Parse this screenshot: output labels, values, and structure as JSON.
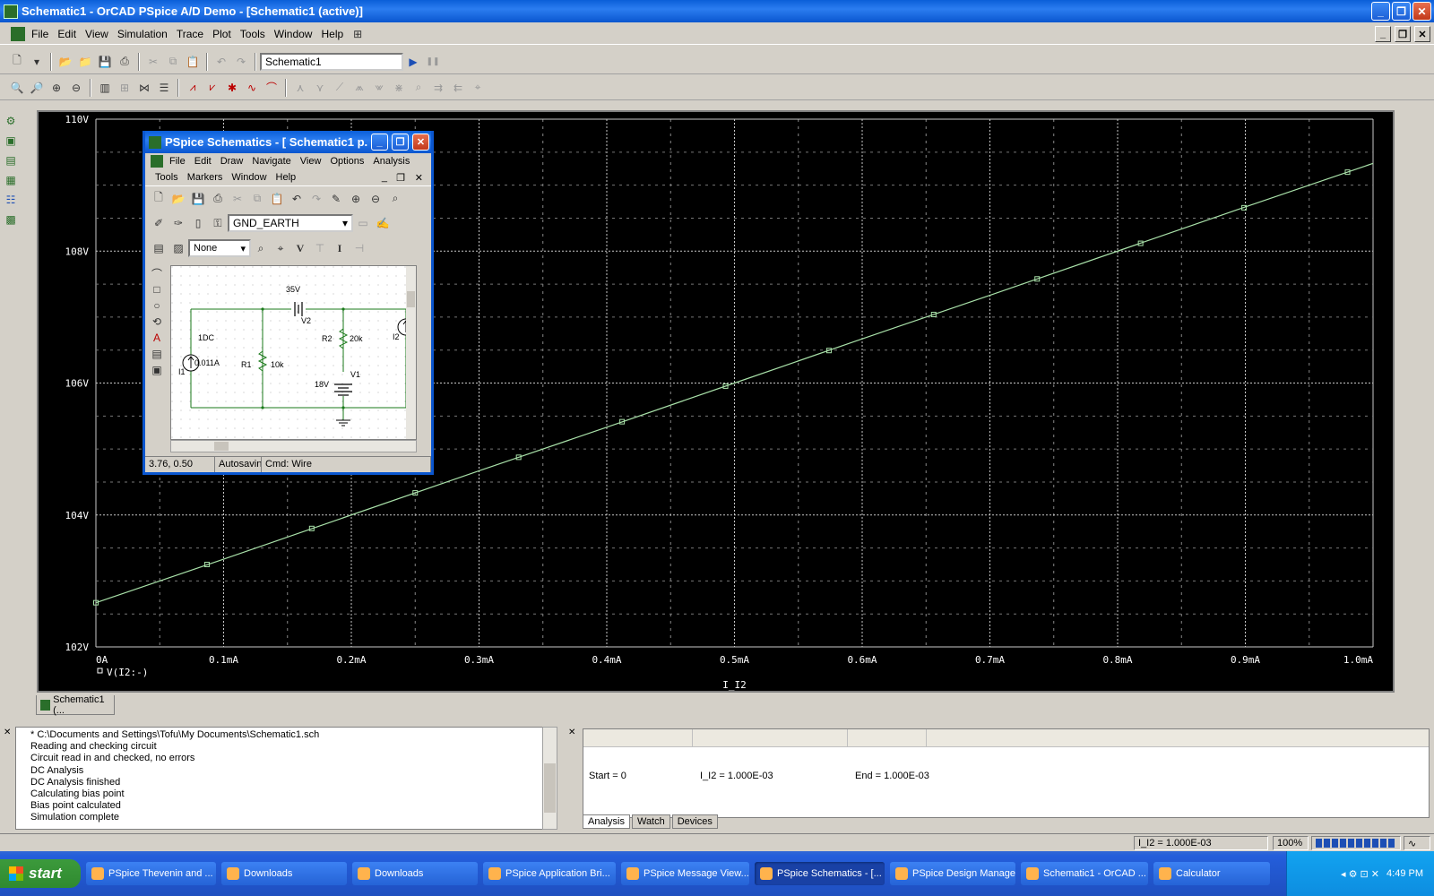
{
  "window": {
    "title": "Schematic1 - OrCAD PSpice A/D Demo  - [Schematic1 (active)]",
    "minimize": "_",
    "maximize": "❐",
    "close": "✕"
  },
  "menu": [
    "File",
    "Edit",
    "View",
    "Simulation",
    "Trace",
    "Plot",
    "Tools",
    "Window",
    "Help"
  ],
  "toolbar": {
    "profile_combo": "Schematic1",
    "run": "▶",
    "pause": "❚❚"
  },
  "plot": {
    "y_ticks": [
      "110V",
      "108V",
      "106V",
      "104V",
      "102V"
    ],
    "x_ticks": [
      "0A",
      "0.1mA",
      "0.2mA",
      "0.3mA",
      "0.4mA",
      "0.5mA",
      "0.6mA",
      "0.7mA",
      "0.8mA",
      "0.9mA",
      "1.0mA"
    ],
    "trace_label": "V(I2:-)",
    "x_label": "I_I2",
    "tab_label": "Schematic1 (..."
  },
  "chart_data": {
    "type": "line",
    "xlabel": "I_I2",
    "ylabel": "",
    "x_unit": "mA",
    "xlim": [
      0,
      1.0
    ],
    "ylim": [
      102,
      110
    ],
    "grid": true,
    "series": [
      {
        "name": "V(I2:-)",
        "x": [
          0,
          0.1,
          0.2,
          0.3,
          0.4,
          0.5,
          0.6,
          0.7,
          0.8,
          0.9,
          1.0
        ],
        "y": [
          102.67,
          103.33,
          104.0,
          104.67,
          105.33,
          106.0,
          106.67,
          107.33,
          108.0,
          108.67,
          109.33
        ]
      }
    ],
    "markers_x": [
      0,
      0.087,
      0.169,
      0.25,
      0.331,
      0.412,
      0.493,
      0.574,
      0.656,
      0.737,
      0.818,
      0.899,
      0.98
    ]
  },
  "schematics": {
    "title": "PSpice Schematics - [ Schematic1  p....",
    "menu_row1": [
      "File",
      "Edit",
      "Draw",
      "Navigate",
      "View",
      "Options",
      "Analysis"
    ],
    "menu_row2": [
      "Tools",
      "Markers",
      "Window",
      "Help"
    ],
    "part_combo": "GND_EARTH",
    "none_combo": "None",
    "v_marker": "V",
    "i_marker": "I",
    "circuit": {
      "vsrc_top": "35V",
      "v2": "V2",
      "i1_dc": "1DC",
      "i1_val": "0.011A",
      "i1": "I1",
      "r1": "R1",
      "r1_val": "10k",
      "r2": "R2",
      "r2_val": "20k",
      "v1": "V1",
      "v1_val": "18V",
      "i2": "I2"
    },
    "status": {
      "coords": "3.76, 0.50",
      "autosave": "Autosaving",
      "cmd": "Cmd: Wire"
    }
  },
  "messages": [
    "* C:\\Documents and Settings\\Tofu\\My Documents\\Schematic1.sch",
    "Reading and checking circuit",
    "Circuit read in and checked, no errors",
    "DC Analysis",
    "DC Analysis finished",
    "Calculating bias point",
    "Bias point calculated",
    "Simulation complete"
  ],
  "sim_status": {
    "start": "Start =  0",
    "current": "I_I2 =  1.000E-03",
    "end": "End =  1.000E-03",
    "tabs": [
      "Analysis",
      "Watch",
      "Devices"
    ]
  },
  "statusbar": {
    "value": "I_I2 = 1.000E-03",
    "zoom": "100%"
  },
  "taskbar": {
    "start": "start",
    "tasks": [
      {
        "label": "PSpice Thevenin and ...",
        "active": false
      },
      {
        "label": "Downloads",
        "active": false
      },
      {
        "label": "Downloads",
        "active": false
      },
      {
        "label": "PSpice Application Bri...",
        "active": false
      },
      {
        "label": "PSpice Message View...",
        "active": false
      },
      {
        "label": "PSpice Schematics - [...",
        "active": true
      },
      {
        "label": "PSpice Design Manager",
        "active": false
      },
      {
        "label": "Schematic1 - OrCAD ...",
        "active": false
      },
      {
        "label": "Calculator",
        "active": false
      }
    ],
    "clock": "4:49 PM"
  },
  "colors": {
    "plot_bg": "#000000",
    "grid": "#c8c8c8",
    "trace": "#a8e0a8",
    "axis_text": "#ffffff",
    "titlebar": "#0a56cf"
  }
}
